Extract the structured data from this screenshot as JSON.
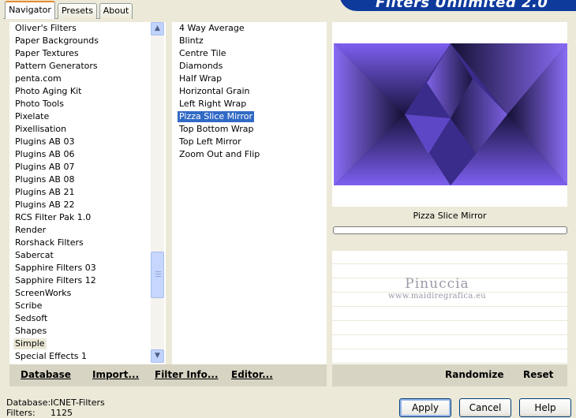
{
  "header": {
    "title": "Filters Unlimited 2.0"
  },
  "tabs": [
    {
      "label": "Navigator",
      "active": true
    },
    {
      "label": "Presets",
      "active": false
    },
    {
      "label": "About",
      "active": false
    }
  ],
  "categories": {
    "items": [
      "Oliver's Filters",
      "Paper Backgrounds",
      "Paper Textures",
      "Pattern Generators",
      "penta.com",
      "Photo Aging Kit",
      "Photo Tools",
      "Pixelate",
      "Pixellisation",
      "Plugins AB 03",
      "Plugins AB 06",
      "Plugins AB 07",
      "Plugins AB 08",
      "Plugins AB 21",
      "Plugins AB 22",
      "RCS Filter Pak 1.0",
      "Render",
      "Rorshack Filters",
      "Sabercat",
      "Sapphire Filters 03",
      "Sapphire Filters 12",
      "ScreenWorks",
      "Scribe",
      "Sedsoft",
      "Shapes",
      "Simple",
      "Special Effects 1"
    ],
    "selected": "Simple"
  },
  "filters": {
    "items": [
      "4 Way Average",
      "Blintz",
      "Centre Tile",
      "Diamonds",
      "Half Wrap",
      "Horizontal Grain",
      "Left Right Wrap",
      "Pizza Slice Mirror",
      "Top Bottom Wrap",
      "Top Left Mirror",
      "Zoom Out and Flip"
    ],
    "selected": "Pizza Slice Mirror"
  },
  "preview": {
    "filter_name": "Pizza Slice Mirror",
    "progress": 0,
    "watermark_name": "Pinuccia",
    "watermark_url": "www.maidiregrafica.eu"
  },
  "left_buttons": {
    "database": "Database",
    "import": "Import...",
    "filter_info": "Filter Info...",
    "editor": "Editor..."
  },
  "right_buttons": {
    "randomize": "Randomize",
    "reset": "Reset"
  },
  "status": {
    "database_label": "Database:",
    "database_value": "ICNET-Filters",
    "filters_label": "Filters:",
    "filters_value": "1125"
  },
  "dialog_buttons": {
    "apply": "Apply",
    "cancel": "Cancel",
    "help": "Help"
  },
  "colors": {
    "accent": "#316ac5",
    "banner": "#0e3a9c",
    "preview_purple": "#7b5cf0"
  }
}
